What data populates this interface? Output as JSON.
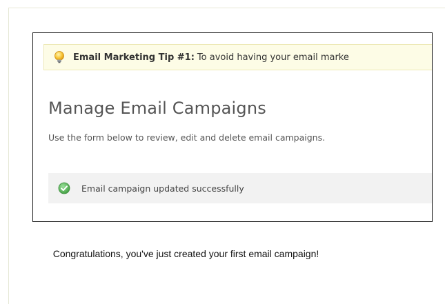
{
  "tip": {
    "icon": "lightbulb-icon",
    "title": "Email Marketing Tip #1:",
    "text": "To avoid having your email marke"
  },
  "page": {
    "title": "Manage Email Campaigns",
    "description": "Use the form below to review, edit and delete email campaigns."
  },
  "status": {
    "icon": "check-circle-icon",
    "message": "Email campaign updated successfully"
  },
  "caption": "Congratulations, you've just created your first email campaign!",
  "colors": {
    "tip_background": "#fdfce6",
    "success_background": "#f2f2f2",
    "success_icon": "#5cb85c"
  }
}
